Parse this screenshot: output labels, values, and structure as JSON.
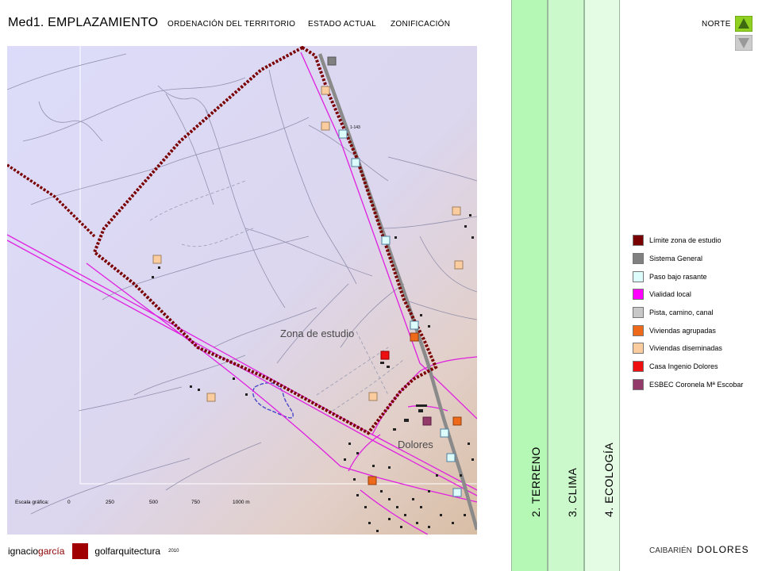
{
  "header": {
    "title": "Med1. EMPLAZAMIENTO",
    "nav": [
      "ORDENACIÓN DEL TERRITORIO",
      "ESTADO ACTUAL",
      "ZONIFICACIÓN"
    ]
  },
  "map": {
    "labels": {
      "study_zone": "Zona de estudio",
      "town": "Dolores",
      "road_code": "1-143"
    },
    "scale": {
      "label": "Escala gráfica:",
      "ticks": [
        "0",
        "250",
        "500",
        "750",
        "1000 m"
      ]
    }
  },
  "tabs": [
    {
      "label": "2. TERRENO",
      "color": "#b5f7b5"
    },
    {
      "label": "3. CLIMA",
      "color": "#ccf9cc"
    },
    {
      "label": "4. ECOLOGÍA",
      "color": "#e3fce3"
    }
  ],
  "north": {
    "label": "NORTE",
    "up_color": "#8fd020",
    "down_color": "#cccccc"
  },
  "legend": [
    {
      "label": "Límite zona de estudio",
      "color": "#7a0000"
    },
    {
      "label": "Sistema General",
      "color": "#808080"
    },
    {
      "label": "Paso bajo rasante",
      "color": "#ddfdfd"
    },
    {
      "label": "Vialidad local",
      "color": "#ff00ff"
    },
    {
      "label": "Pista, camino, canal",
      "color": "#c8c8c8"
    },
    {
      "label": "Viviendas agrupadas",
      "color": "#ee6a1a"
    },
    {
      "label": "Viviendas diseminadas",
      "color": "#fbcc9e"
    },
    {
      "label": "Casa Ingenio Dolores",
      "color": "#ee1010"
    },
    {
      "label": "ESBEC Coronela Mª Escobar",
      "color": "#943a6a"
    }
  ],
  "footer": {
    "author_first": "ignacio",
    "author_last": "garcía",
    "brand": "golfarquitectura",
    "year": "2010",
    "region": "CAIBARIÉN",
    "place": "DOLORES"
  }
}
